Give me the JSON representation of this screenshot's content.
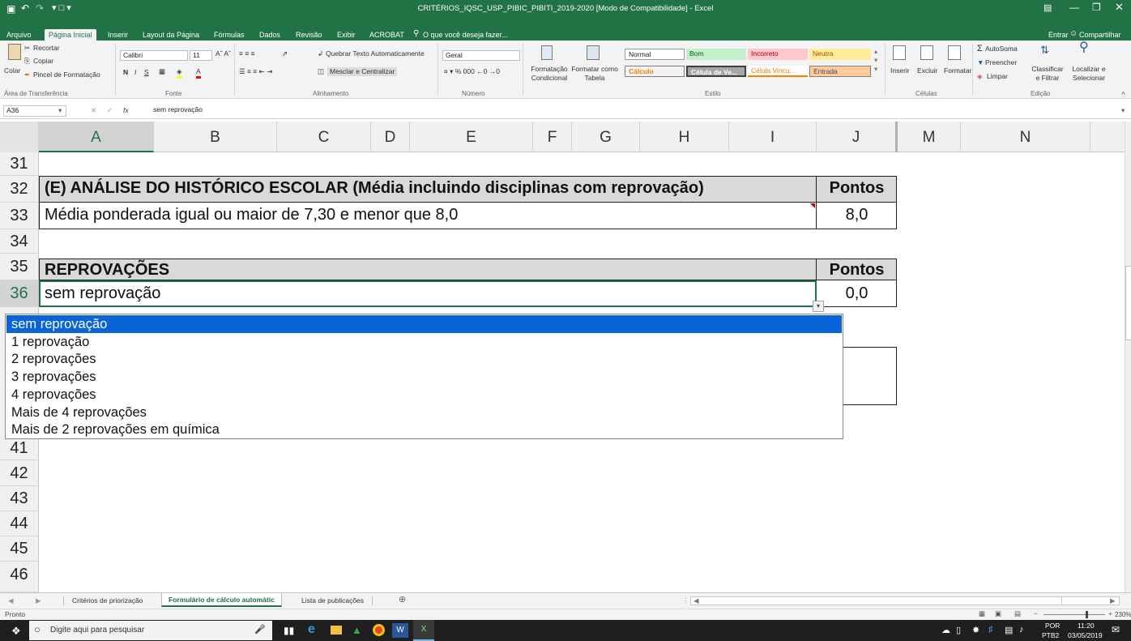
{
  "window": {
    "title": "CRITÉRIOS_IQSC_USP_PIBIC_PIBITI_2019-2020 [Modo de Compatibilidade] - Excel"
  },
  "tabs": [
    "Arquivo",
    "Página Inicial",
    "Inserir",
    "Layout da Página",
    "Fórmulas",
    "Dados",
    "Revisão",
    "Exibir",
    "ACROBAT"
  ],
  "tell_me": "O que você deseja fazer...",
  "account": {
    "signin": "Entrar",
    "share": "Compartilhar"
  },
  "ribbon": {
    "clipboard": {
      "paste": "Colar",
      "cut": "Recortar",
      "copy": "Copiar",
      "painter": "Pincel de Formatação",
      "group": "Área de Transferência"
    },
    "font": {
      "name": "Calibri",
      "size": "11",
      "group": "Fonte"
    },
    "alignment": {
      "wrap": "Quebrar Texto Automaticamente",
      "merge": "Mesclar e Centralizar",
      "group": "Alinhamento"
    },
    "number": {
      "format": "Geral",
      "group": "Número"
    },
    "styles": {
      "conditional": "Formatação Condicional",
      "table": "Formatar como Tabela",
      "group": "Estilo",
      "cells": [
        {
          "label": "Normal",
          "bg": "#ffffff",
          "fg": "#000000",
          "border": "#9a9a9a"
        },
        {
          "label": "Bom",
          "bg": "#c6efce",
          "fg": "#006100",
          "border": "#c6efce"
        },
        {
          "label": "Incorreto",
          "bg": "#ffc7ce",
          "fg": "#9c0006",
          "border": "#ffc7ce"
        },
        {
          "label": "Neutra",
          "bg": "#ffeb9c",
          "fg": "#9c5700",
          "border": "#ffeb9c"
        },
        {
          "label": "Cálculo",
          "bg": "#f2f2f2",
          "fg": "#fa7d00",
          "border": "#7f7f7f"
        },
        {
          "label": "Célula de Ve...",
          "bg": "#a5a5a5",
          "fg": "#ffffff",
          "border": "#3f3f3f"
        },
        {
          "label": "Célula Vincu...",
          "bg": "#ffffff",
          "fg": "#fa7d00",
          "border": "#ffffff"
        },
        {
          "label": "Entrada",
          "bg": "#ffcc99",
          "fg": "#3f3f76",
          "border": "#7f7f7f"
        }
      ]
    },
    "cells": {
      "insert": "Inserir",
      "delete": "Excluir",
      "format": "Formatar",
      "group": "Células"
    },
    "editing": {
      "autosum": "AutoSoma",
      "fill": "Preencher",
      "clear": "Limpar",
      "sort": "Classificar e Filtrar",
      "find": "Localizar e Selecionar",
      "group": "Edição"
    }
  },
  "formula_bar": {
    "name_box": "A36",
    "fx": "fx",
    "content": "sem reprovação"
  },
  "columns": [
    "A",
    "B",
    "C",
    "D",
    "E",
    "F",
    "G",
    "H",
    "I",
    "J",
    "M",
    "N"
  ],
  "rows": [
    {
      "num": "31",
      "text": "",
      "points": ""
    },
    {
      "num": "32",
      "text": "(E) ANÁLISE DO HISTÓRICO ESCOLAR (Média incluindo disciplinas com reprovação)",
      "points": "Pontos"
    },
    {
      "num": "33",
      "text": "Média ponderada igual ou maior de 7,30 e menor que 8,0",
      "points": "8,0"
    },
    {
      "num": "34",
      "text": "",
      "points": ""
    },
    {
      "num": "35",
      "text": "REPROVAÇÕES",
      "points": "Pontos"
    },
    {
      "num": "36",
      "text": "sem reprovação",
      "points": "0,0"
    }
  ],
  "lower_rows": [
    "41",
    "42",
    "43",
    "44",
    "45",
    "46"
  ],
  "dropdown": {
    "options": [
      "sem reprovação",
      "1 reprovação",
      "2 reprovações",
      "3 reprovações",
      "4 reprovações",
      "Mais de 4 reprovações",
      "Mais de 2 reprovações em química"
    ],
    "selected_index": 0
  },
  "sheets": [
    {
      "name": "Critérios de priorização",
      "active": false
    },
    {
      "name": "Formulário de cálculo automátic",
      "active": true
    },
    {
      "name": "Lista de publicações",
      "active": false
    }
  ],
  "status": {
    "mode": "Pronto",
    "zoom": "230%"
  },
  "taskbar": {
    "search": "Digite aqui para pesquisar",
    "lang": "POR",
    "layout": "PTB2",
    "time": "11:20",
    "date": "03/05/2019"
  },
  "colors": {
    "excel_green": "#217346",
    "header_gray": "#d9d9d9",
    "selection_blue": "#0a64d6"
  }
}
